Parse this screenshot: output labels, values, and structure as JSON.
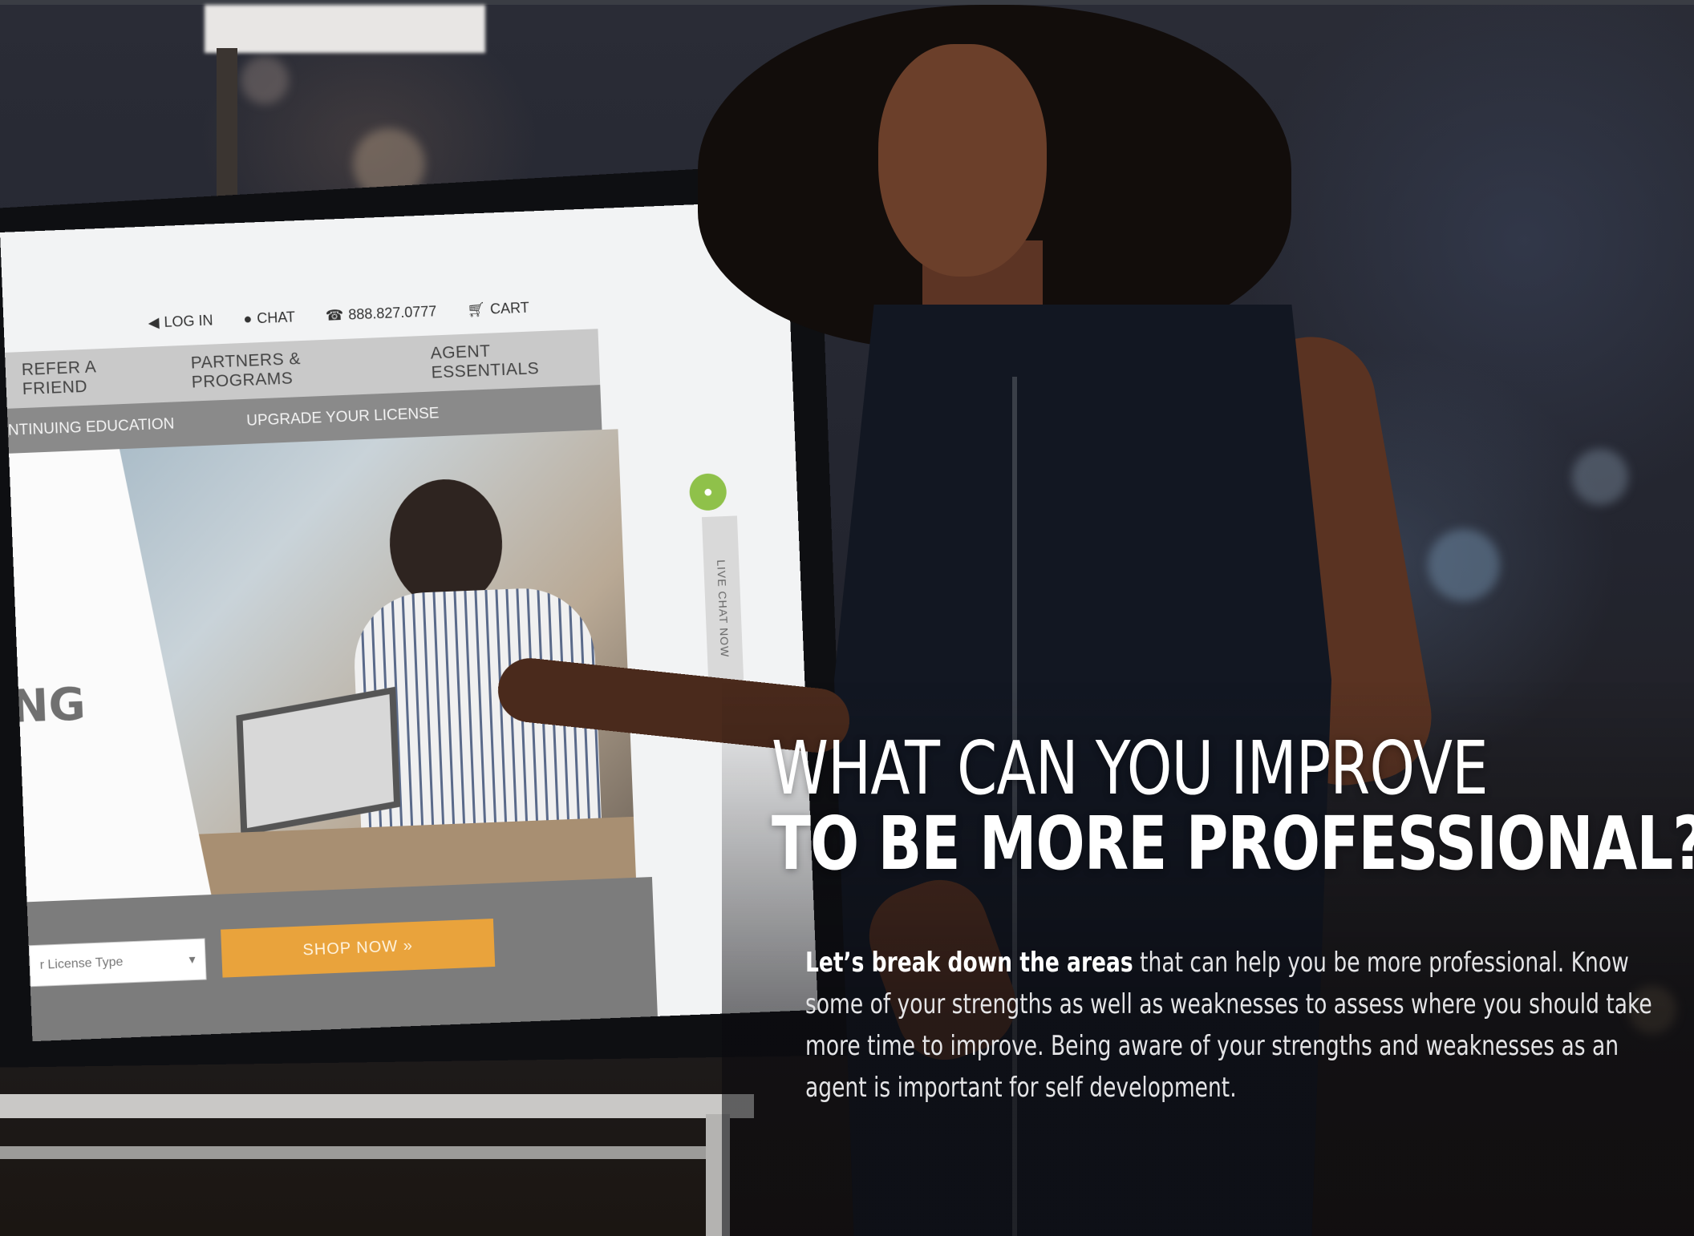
{
  "tv_screen": {
    "topbar": {
      "login": "LOG IN",
      "chat": "CHAT",
      "phone": "888.827.0777",
      "cart": "CART"
    },
    "nav_primary": [
      "REFER A FRIEND",
      "PARTNERS & PROGRAMS",
      "AGENT ESSENTIALS"
    ],
    "nav_secondary": [
      "NTINUING EDUCATION",
      "UPGRADE YOUR LICENSE"
    ],
    "hero_fragment": "NG",
    "select_placeholder": "r License Type",
    "shop_button": "SHOP NOW »",
    "chat_tab": "LIVE CHAT NOW"
  },
  "headline": {
    "line1": "WHAT CAN YOU IMPROVE",
    "line2_prefix": "TO BE ",
    "line2_bold": "MORE PROFESSIONAL?"
  },
  "body": {
    "lead": "Let’s break down the areas",
    "rest": " that can help you be more professional. Know some of your strengths as well as weaknesses to assess where you should take more time to improve. Being aware of your strengths and weaknesses as an agent is important for self development."
  },
  "colors": {
    "shop_button": "#e9a33c",
    "chat_bubble": "#8fc14a",
    "headline_text": "#ffffff"
  }
}
